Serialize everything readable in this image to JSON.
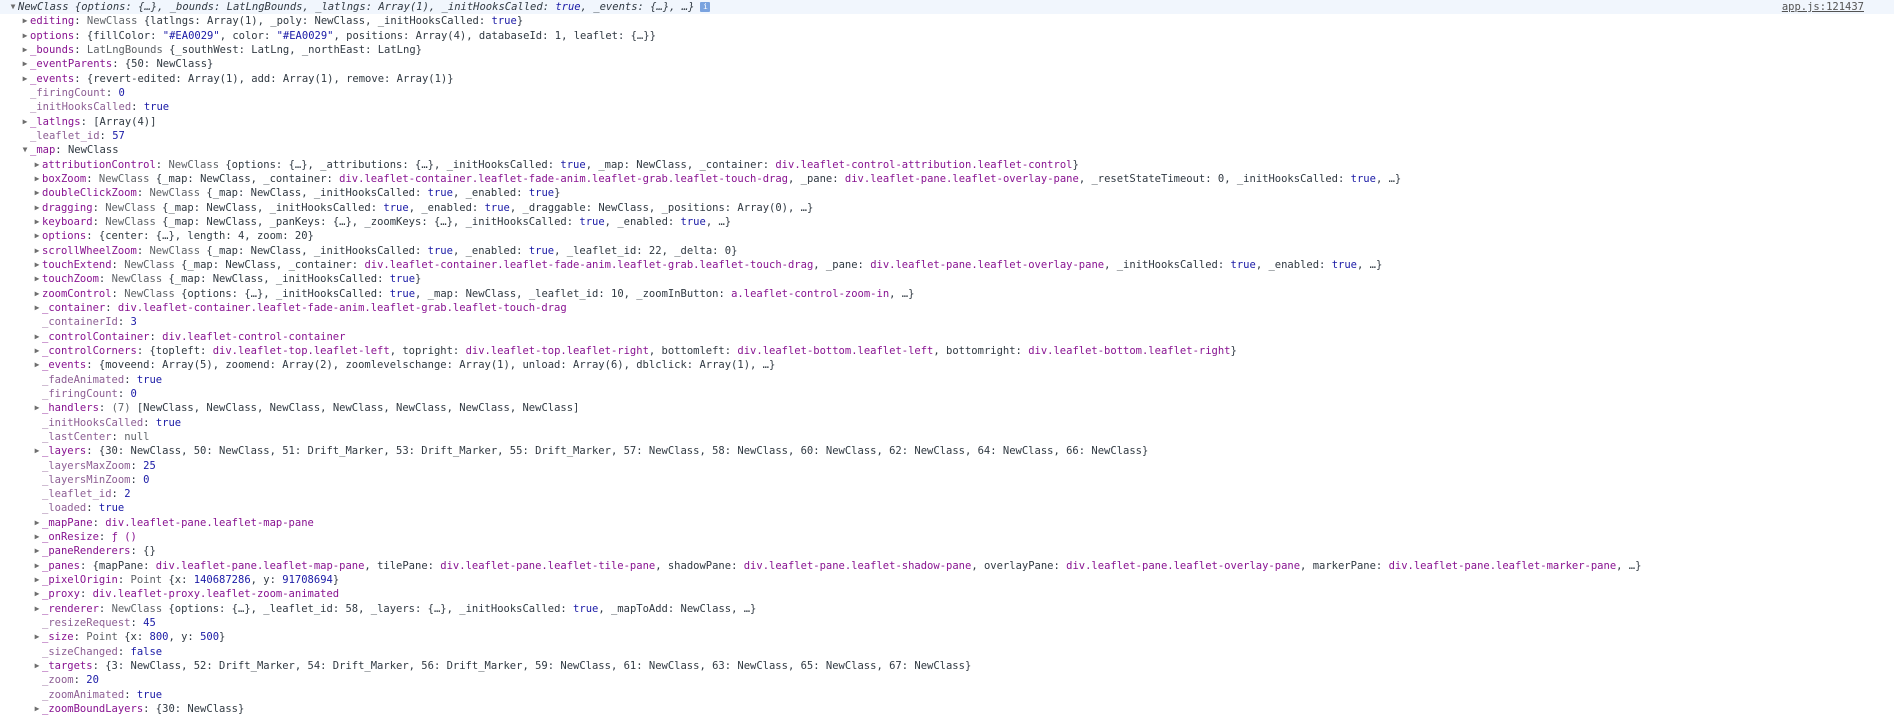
{
  "source_link": "app.js:121437",
  "rows": [
    {
      "indent": 0,
      "expander": "down",
      "first": true,
      "italic": true,
      "segs": [
        [
          "p",
          "NewClass "
        ],
        [
          "p",
          "{options: {…}, _bounds: LatLngBounds, _latlngs: Array(1), _initHooksCalled: "
        ],
        [
          "o",
          "true"
        ],
        [
          "p",
          ", _events: {…}, …}"
        ]
      ]
    },
    {
      "indent": 1,
      "expander": "right",
      "segs": [
        [
          "k",
          "editing"
        ],
        [
          "p",
          ": "
        ],
        [
          "g",
          "NewClass "
        ],
        [
          "p",
          "{latlngs: Array(1), _poly: NewClass, _initHooksCalled: "
        ],
        [
          "o",
          "true"
        ],
        [
          "p",
          "}"
        ]
      ]
    },
    {
      "indent": 1,
      "expander": "right",
      "segs": [
        [
          "k",
          "options"
        ],
        [
          "p",
          ": {fillColor: "
        ],
        [
          "o",
          "\"#EA0029\""
        ],
        [
          "p",
          ", color: "
        ],
        [
          "o",
          "\"#EA0029\""
        ],
        [
          "p",
          ", positions: Array(4), databaseId: 1, leaflet: {…}}"
        ]
      ]
    },
    {
      "indent": 1,
      "expander": "right",
      "segs": [
        [
          "k",
          "_bounds"
        ],
        [
          "p",
          ": "
        ],
        [
          "g",
          "LatLngBounds "
        ],
        [
          "p",
          "{_southWest: LatLng, _northEast: LatLng}"
        ]
      ]
    },
    {
      "indent": 1,
      "expander": "right",
      "segs": [
        [
          "k",
          "_eventParents"
        ],
        [
          "p",
          ": {50: NewClass}"
        ]
      ]
    },
    {
      "indent": 1,
      "expander": "right",
      "segs": [
        [
          "k",
          "_events"
        ],
        [
          "p",
          ": {revert-edited: Array(1), add: Array(1), remove: Array(1)}"
        ]
      ]
    },
    {
      "indent": 1,
      "expander": "none",
      "segs": [
        [
          "dk",
          "_firingCount"
        ],
        [
          "p",
          ": "
        ],
        [
          "o",
          "0"
        ]
      ]
    },
    {
      "indent": 1,
      "expander": "none",
      "segs": [
        [
          "dk",
          "_initHooksCalled"
        ],
        [
          "p",
          ": "
        ],
        [
          "o",
          "true"
        ]
      ]
    },
    {
      "indent": 1,
      "expander": "right",
      "segs": [
        [
          "k",
          "_latlngs"
        ],
        [
          "p",
          ": [Array(4)]"
        ]
      ]
    },
    {
      "indent": 1,
      "expander": "none",
      "segs": [
        [
          "dk",
          "_leaflet_id"
        ],
        [
          "p",
          ": "
        ],
        [
          "o",
          "57"
        ]
      ]
    },
    {
      "indent": 1,
      "expander": "down",
      "segs": [
        [
          "k",
          "_map"
        ],
        [
          "p",
          ": NewClass"
        ]
      ]
    },
    {
      "indent": 2,
      "expander": "right",
      "segs": [
        [
          "k",
          "attributionControl"
        ],
        [
          "p",
          ": "
        ],
        [
          "g",
          "NewClass "
        ],
        [
          "p",
          "{options: {…}, _attributions: {…}, _initHooksCalled: "
        ],
        [
          "o",
          "true"
        ],
        [
          "p",
          ", _map: NewClass, _container: "
        ],
        [
          "k",
          "div.leaflet-control-attribution.leaflet-control"
        ],
        [
          "p",
          "}"
        ]
      ]
    },
    {
      "indent": 2,
      "expander": "right",
      "segs": [
        [
          "k",
          "boxZoom"
        ],
        [
          "p",
          ": "
        ],
        [
          "g",
          "NewClass "
        ],
        [
          "p",
          "{_map: NewClass, _container: "
        ],
        [
          "k",
          "div.leaflet-container.leaflet-fade-anim.leaflet-grab.leaflet-touch-drag"
        ],
        [
          "p",
          ", _pane: "
        ],
        [
          "k",
          "div.leaflet-pane.leaflet-overlay-pane"
        ],
        [
          "p",
          ", _resetStateTimeout: 0, _initHooksCalled: "
        ],
        [
          "o",
          "true"
        ],
        [
          "p",
          ", …}"
        ]
      ]
    },
    {
      "indent": 2,
      "expander": "right",
      "segs": [
        [
          "k",
          "doubleClickZoom"
        ],
        [
          "p",
          ": "
        ],
        [
          "g",
          "NewClass "
        ],
        [
          "p",
          "{_map: NewClass, _initHooksCalled: "
        ],
        [
          "o",
          "true"
        ],
        [
          "p",
          ", _enabled: "
        ],
        [
          "o",
          "true"
        ],
        [
          "p",
          "}"
        ]
      ]
    },
    {
      "indent": 2,
      "expander": "right",
      "segs": [
        [
          "k",
          "dragging"
        ],
        [
          "p",
          ": "
        ],
        [
          "g",
          "NewClass "
        ],
        [
          "p",
          "{_map: NewClass, _initHooksCalled: "
        ],
        [
          "o",
          "true"
        ],
        [
          "p",
          ", _enabled: "
        ],
        [
          "o",
          "true"
        ],
        [
          "p",
          ", _draggable: NewClass, _positions: Array(0), …}"
        ]
      ]
    },
    {
      "indent": 2,
      "expander": "right",
      "segs": [
        [
          "k",
          "keyboard"
        ],
        [
          "p",
          ": "
        ],
        [
          "g",
          "NewClass "
        ],
        [
          "p",
          "{_map: NewClass, _panKeys: {…}, _zoomKeys: {…}, _initHooksCalled: "
        ],
        [
          "o",
          "true"
        ],
        [
          "p",
          ", _enabled: "
        ],
        [
          "o",
          "true"
        ],
        [
          "p",
          ", …}"
        ]
      ]
    },
    {
      "indent": 2,
      "expander": "right",
      "segs": [
        [
          "k",
          "options"
        ],
        [
          "p",
          ": {center: {…}, length: 4, zoom: 20}"
        ]
      ]
    },
    {
      "indent": 2,
      "expander": "right",
      "segs": [
        [
          "k",
          "scrollWheelZoom"
        ],
        [
          "p",
          ": "
        ],
        [
          "g",
          "NewClass "
        ],
        [
          "p",
          "{_map: NewClass, _initHooksCalled: "
        ],
        [
          "o",
          "true"
        ],
        [
          "p",
          ", _enabled: "
        ],
        [
          "o",
          "true"
        ],
        [
          "p",
          ", _leaflet_id: 22, _delta: 0}"
        ]
      ]
    },
    {
      "indent": 2,
      "expander": "right",
      "segs": [
        [
          "k",
          "touchExtend"
        ],
        [
          "p",
          ": "
        ],
        [
          "g",
          "NewClass "
        ],
        [
          "p",
          "{_map: NewClass, _container: "
        ],
        [
          "k",
          "div.leaflet-container.leaflet-fade-anim.leaflet-grab.leaflet-touch-drag"
        ],
        [
          "p",
          ", _pane: "
        ],
        [
          "k",
          "div.leaflet-pane.leaflet-overlay-pane"
        ],
        [
          "p",
          ", _initHooksCalled: "
        ],
        [
          "o",
          "true"
        ],
        [
          "p",
          ", _enabled: "
        ],
        [
          "o",
          "true"
        ],
        [
          "p",
          ", …}"
        ]
      ]
    },
    {
      "indent": 2,
      "expander": "right",
      "segs": [
        [
          "k",
          "touchZoom"
        ],
        [
          "p",
          ": "
        ],
        [
          "g",
          "NewClass "
        ],
        [
          "p",
          "{_map: NewClass, _initHooksCalled: "
        ],
        [
          "o",
          "true"
        ],
        [
          "p",
          "}"
        ]
      ]
    },
    {
      "indent": 2,
      "expander": "right",
      "segs": [
        [
          "k",
          "zoomControl"
        ],
        [
          "p",
          ": "
        ],
        [
          "g",
          "NewClass "
        ],
        [
          "p",
          "{options: {…}, _initHooksCalled: "
        ],
        [
          "o",
          "true"
        ],
        [
          "p",
          ", _map: NewClass, _leaflet_id: 10, _zoomInButton: "
        ],
        [
          "k",
          "a.leaflet-control-zoom-in"
        ],
        [
          "p",
          ", …}"
        ]
      ]
    },
    {
      "indent": 2,
      "expander": "right",
      "segs": [
        [
          "k",
          "_container"
        ],
        [
          "p",
          ": "
        ],
        [
          "k",
          "div.leaflet-container.leaflet-fade-anim.leaflet-grab.leaflet-touch-drag"
        ]
      ]
    },
    {
      "indent": 2,
      "expander": "none",
      "segs": [
        [
          "dk",
          "_containerId"
        ],
        [
          "p",
          ": "
        ],
        [
          "o",
          "3"
        ]
      ]
    },
    {
      "indent": 2,
      "expander": "right",
      "segs": [
        [
          "k",
          "_controlContainer"
        ],
        [
          "p",
          ": "
        ],
        [
          "k",
          "div.leaflet-control-container"
        ]
      ]
    },
    {
      "indent": 2,
      "expander": "right",
      "segs": [
        [
          "k",
          "_controlCorners"
        ],
        [
          "p",
          ": {topleft: "
        ],
        [
          "k",
          "div.leaflet-top.leaflet-left"
        ],
        [
          "p",
          ", topright: "
        ],
        [
          "k",
          "div.leaflet-top.leaflet-right"
        ],
        [
          "p",
          ", bottomleft: "
        ],
        [
          "k",
          "div.leaflet-bottom.leaflet-left"
        ],
        [
          "p",
          ", bottomright: "
        ],
        [
          "k",
          "div.leaflet-bottom.leaflet-right"
        ],
        [
          "p",
          "}"
        ]
      ]
    },
    {
      "indent": 2,
      "expander": "right",
      "segs": [
        [
          "k",
          "_events"
        ],
        [
          "p",
          ": {moveend: Array(5), zoomend: Array(2), zoomlevelschange: Array(1), unload: Array(6), dblclick: Array(1), …}"
        ]
      ]
    },
    {
      "indent": 2,
      "expander": "none",
      "segs": [
        [
          "dk",
          "_fadeAnimated"
        ],
        [
          "p",
          ": "
        ],
        [
          "o",
          "true"
        ]
      ]
    },
    {
      "indent": 2,
      "expander": "none",
      "segs": [
        [
          "dk",
          "_firingCount"
        ],
        [
          "p",
          ": "
        ],
        [
          "o",
          "0"
        ]
      ]
    },
    {
      "indent": 2,
      "expander": "right",
      "segs": [
        [
          "k",
          "_handlers"
        ],
        [
          "p",
          ": "
        ],
        [
          "g",
          "(7) "
        ],
        [
          "p",
          "[NewClass, NewClass, NewClass, NewClass, NewClass, NewClass, NewClass]"
        ]
      ]
    },
    {
      "indent": 2,
      "expander": "none",
      "segs": [
        [
          "dk",
          "_initHooksCalled"
        ],
        [
          "p",
          ": "
        ],
        [
          "o",
          "true"
        ]
      ]
    },
    {
      "indent": 2,
      "expander": "none",
      "segs": [
        [
          "dk",
          "_lastCenter"
        ],
        [
          "p",
          ": "
        ],
        [
          "g",
          "null"
        ]
      ]
    },
    {
      "indent": 2,
      "expander": "right",
      "segs": [
        [
          "k",
          "_layers"
        ],
        [
          "p",
          ": {30: NewClass, 50: NewClass, 51: Drift_Marker, 53: Drift_Marker, 55: Drift_Marker, 57: NewClass, 58: NewClass, 60: NewClass, 62: NewClass, 64: NewClass, 66: NewClass}"
        ]
      ]
    },
    {
      "indent": 2,
      "expander": "none",
      "segs": [
        [
          "dk",
          "_layersMaxZoom"
        ],
        [
          "p",
          ": "
        ],
        [
          "o",
          "25"
        ]
      ]
    },
    {
      "indent": 2,
      "expander": "none",
      "segs": [
        [
          "dk",
          "_layersMinZoom"
        ],
        [
          "p",
          ": "
        ],
        [
          "o",
          "0"
        ]
      ]
    },
    {
      "indent": 2,
      "expander": "none",
      "segs": [
        [
          "dk",
          "_leaflet_id"
        ],
        [
          "p",
          ": "
        ],
        [
          "o",
          "2"
        ]
      ]
    },
    {
      "indent": 2,
      "expander": "none",
      "segs": [
        [
          "dk",
          "_loaded"
        ],
        [
          "p",
          ": "
        ],
        [
          "o",
          "true"
        ]
      ]
    },
    {
      "indent": 2,
      "expander": "right",
      "segs": [
        [
          "k",
          "_mapPane"
        ],
        [
          "p",
          ": "
        ],
        [
          "k",
          "div.leaflet-pane.leaflet-map-pane"
        ]
      ]
    },
    {
      "indent": 2,
      "expander": "right",
      "segs": [
        [
          "k",
          "_onResize"
        ],
        [
          "p",
          ": "
        ],
        [
          "k",
          "ƒ ()"
        ]
      ]
    },
    {
      "indent": 2,
      "expander": "right",
      "segs": [
        [
          "k",
          "_paneRenderers"
        ],
        [
          "p",
          ": {}"
        ]
      ]
    },
    {
      "indent": 2,
      "expander": "right",
      "segs": [
        [
          "k",
          "_panes"
        ],
        [
          "p",
          ": {mapPane: "
        ],
        [
          "k",
          "div.leaflet-pane.leaflet-map-pane"
        ],
        [
          "p",
          ", tilePane: "
        ],
        [
          "k",
          "div.leaflet-pane.leaflet-tile-pane"
        ],
        [
          "p",
          ", shadowPane: "
        ],
        [
          "k",
          "div.leaflet-pane.leaflet-shadow-pane"
        ],
        [
          "p",
          ", overlayPane: "
        ],
        [
          "k",
          "div.leaflet-pane.leaflet-overlay-pane"
        ],
        [
          "p",
          ", markerPane: "
        ],
        [
          "k",
          "div.leaflet-pane.leaflet-marker-pane"
        ],
        [
          "p",
          ", …}"
        ]
      ]
    },
    {
      "indent": 2,
      "expander": "right",
      "segs": [
        [
          "k",
          "_pixelOrigin"
        ],
        [
          "p",
          ": "
        ],
        [
          "g",
          "Point "
        ],
        [
          "p",
          "{x: "
        ],
        [
          "o",
          "140687286"
        ],
        [
          "p",
          ", y: "
        ],
        [
          "o",
          "91708694"
        ],
        [
          "p",
          "}"
        ]
      ]
    },
    {
      "indent": 2,
      "expander": "right",
      "segs": [
        [
          "k",
          "_proxy"
        ],
        [
          "p",
          ": "
        ],
        [
          "k",
          "div.leaflet-proxy.leaflet-zoom-animated"
        ]
      ]
    },
    {
      "indent": 2,
      "expander": "right",
      "segs": [
        [
          "k",
          "_renderer"
        ],
        [
          "p",
          ": "
        ],
        [
          "g",
          "NewClass "
        ],
        [
          "p",
          "{options: {…}, _leaflet_id: 58, _layers: {…}, _initHooksCalled: "
        ],
        [
          "o",
          "true"
        ],
        [
          "p",
          ", _mapToAdd: NewClass, …}"
        ]
      ]
    },
    {
      "indent": 2,
      "expander": "none",
      "segs": [
        [
          "dk",
          "_resizeRequest"
        ],
        [
          "p",
          ": "
        ],
        [
          "o",
          "45"
        ]
      ]
    },
    {
      "indent": 2,
      "expander": "right",
      "segs": [
        [
          "k",
          "_size"
        ],
        [
          "p",
          ": "
        ],
        [
          "g",
          "Point "
        ],
        [
          "p",
          "{x: "
        ],
        [
          "o",
          "800"
        ],
        [
          "p",
          ", y: "
        ],
        [
          "o",
          "500"
        ],
        [
          "p",
          "}"
        ]
      ]
    },
    {
      "indent": 2,
      "expander": "none",
      "segs": [
        [
          "dk",
          "_sizeChanged"
        ],
        [
          "p",
          ": "
        ],
        [
          "o",
          "false"
        ]
      ]
    },
    {
      "indent": 2,
      "expander": "right",
      "segs": [
        [
          "k",
          "_targets"
        ],
        [
          "p",
          ": {3: NewClass, 52: Drift_Marker, 54: Drift_Marker, 56: Drift_Marker, 59: NewClass, 61: NewClass, 63: NewClass, 65: NewClass, 67: NewClass}"
        ]
      ]
    },
    {
      "indent": 2,
      "expander": "none",
      "segs": [
        [
          "dk",
          "_zoom"
        ],
        [
          "p",
          ": "
        ],
        [
          "o",
          "20"
        ]
      ]
    },
    {
      "indent": 2,
      "expander": "none",
      "segs": [
        [
          "dk",
          "_zoomAnimated"
        ],
        [
          "p",
          ": "
        ],
        [
          "o",
          "true"
        ]
      ]
    },
    {
      "indent": 2,
      "expander": "right",
      "segs": [
        [
          "k",
          "_zoomBoundLayers"
        ],
        [
          "p",
          ": {30: NewClass}"
        ]
      ]
    }
  ]
}
